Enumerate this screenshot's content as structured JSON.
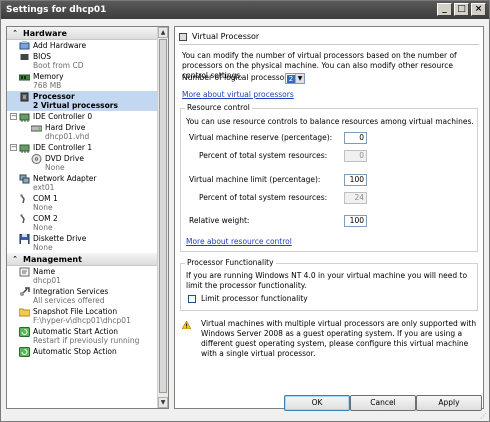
{
  "window": {
    "title": "Settings for dhcp01"
  },
  "tree": {
    "hardware_header": "Hardware",
    "hardware_items": [
      {
        "label": "Add Hardware",
        "sub": ""
      },
      {
        "label": "BIOS",
        "sub": "Boot from CD"
      },
      {
        "label": "Memory",
        "sub": "768 MB"
      },
      {
        "label": "Processor",
        "sub": "2 Virtual processors"
      },
      {
        "label": "IDE Controller 0",
        "sub": ""
      },
      {
        "label": "Hard Drive",
        "sub": "dhcp01.vhd"
      },
      {
        "label": "IDE Controller 1",
        "sub": ""
      },
      {
        "label": "DVD Drive",
        "sub": "None"
      },
      {
        "label": "Network Adapter",
        "sub": "ext01"
      },
      {
        "label": "COM 1",
        "sub": "None"
      },
      {
        "label": "COM 2",
        "sub": "None"
      },
      {
        "label": "Diskette Drive",
        "sub": "None"
      }
    ],
    "management_header": "Management",
    "management_items": [
      {
        "label": "Name",
        "sub": "dhcp01"
      },
      {
        "label": "Integration Services",
        "sub": "All services offered"
      },
      {
        "label": "Snapshot File Location",
        "sub": "F:\\hyper-v\\dhcp01\\dhcp01"
      },
      {
        "label": "Automatic Start Action",
        "sub": "Restart if previously running"
      },
      {
        "label": "Automatic Stop Action",
        "sub": ""
      }
    ]
  },
  "pane": {
    "title": "Virtual Processor",
    "intro": "You can modify the number of virtual processors based on the number of processors on the physical machine. You can also modify other resource control settings.",
    "num_label": "Number of logical processors:",
    "num_value": "2",
    "more_vp_link": "More about virtual processors",
    "resource": {
      "title": "Resource control",
      "desc": "You can use resource controls to balance resources among virtual machines.",
      "reserve_label": "Virtual machine reserve (percentage):",
      "reserve_value": "0",
      "reserve_pct_label": "Percent of total system resources:",
      "reserve_pct_value": "0",
      "limit_label": "Virtual machine limit (percentage):",
      "limit_value": "100",
      "limit_pct_label": "Percent of total system resources:",
      "limit_pct_value": "24",
      "weight_label": "Relative weight:",
      "weight_value": "100",
      "more_rc_link": "More about resource control"
    },
    "functionality": {
      "title": "Processor Functionality",
      "desc": "If you are running Windows NT 4.0 in your virtual machine you will need to limit the processor functionality.",
      "checkbox_label": "Limit processor functionality"
    },
    "warning": "Virtual machines with multiple virtual processors are only supported with Windows Server 2008 as a guest operating system. If you are using a different guest operating system, please configure this virtual machine with a single virtual processor."
  },
  "buttons": {
    "ok": "OK",
    "cancel": "Cancel",
    "apply": "Apply"
  }
}
